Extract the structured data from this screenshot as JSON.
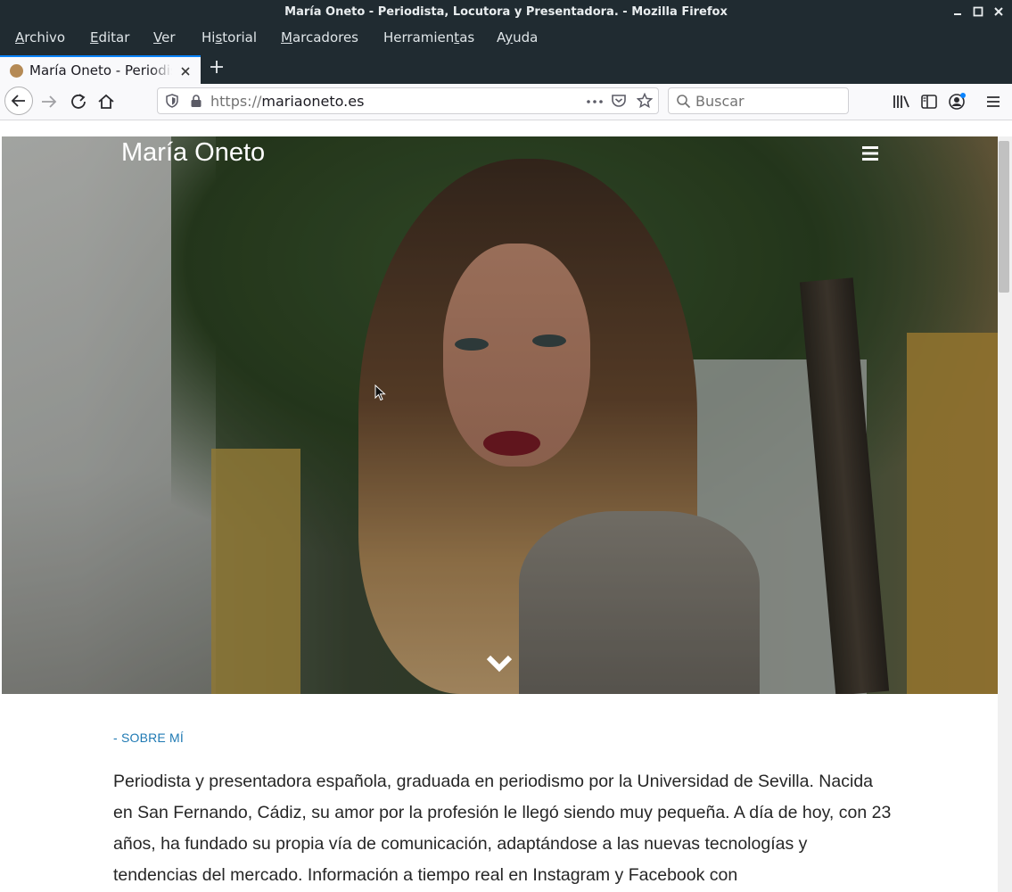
{
  "window": {
    "title": "María Oneto - Periodista, Locutora y Presentadora. - Mozilla Firefox"
  },
  "menubar": {
    "items": [
      {
        "label": "Archivo",
        "accel": "A"
      },
      {
        "label": "Editar",
        "accel": "E"
      },
      {
        "label": "Ver",
        "accel": "V"
      },
      {
        "label": "Historial",
        "accel": "s"
      },
      {
        "label": "Marcadores",
        "accel": "M"
      },
      {
        "label": "Herramientas",
        "accel": "t"
      },
      {
        "label": "Ayuda",
        "accel": "y"
      }
    ]
  },
  "tab": {
    "title": "María Oneto - Periodista, Locutora y Presentadora."
  },
  "navbar": {
    "url_scheme": "https://",
    "url_host": "mariaoneto.es",
    "search_placeholder": "Buscar"
  },
  "hero": {
    "site_title": "María Oneto"
  },
  "content": {
    "section_label": "- SOBRE MÍ",
    "bio": "Periodista y presentadora española, graduada en periodismo por la Universidad de Sevilla. Nacida en San Fernando, Cádiz, su amor por la profesión le llegó siendo muy pequeña. A día de hoy, con 23 años, ha fundado su propia vía de comunicación, adaptándose a las nuevas tecnologías y tendencias del mercado. Información a tiempo real en Instagram y Facebook con"
  },
  "colors": {
    "chrome_dark": "#202b31",
    "tab_accent": "#0a84ff",
    "section_label": "#1e79b3",
    "body_text": "#262626"
  },
  "icons": [
    "minimize-icon",
    "maximize-icon",
    "close-icon",
    "favicon-icon",
    "tab-close-icon",
    "new-tab-icon",
    "back-icon",
    "forward-icon",
    "reload-icon",
    "home-icon",
    "tracking-shield-icon",
    "lock-icon",
    "page-actions-icon",
    "pocket-icon",
    "bookmark-star-icon",
    "search-icon",
    "library-icon",
    "sidebar-icon",
    "account-icon",
    "app-menu-icon",
    "hamburger-icon",
    "chevron-down-icon",
    "mouse-cursor-icon"
  ]
}
